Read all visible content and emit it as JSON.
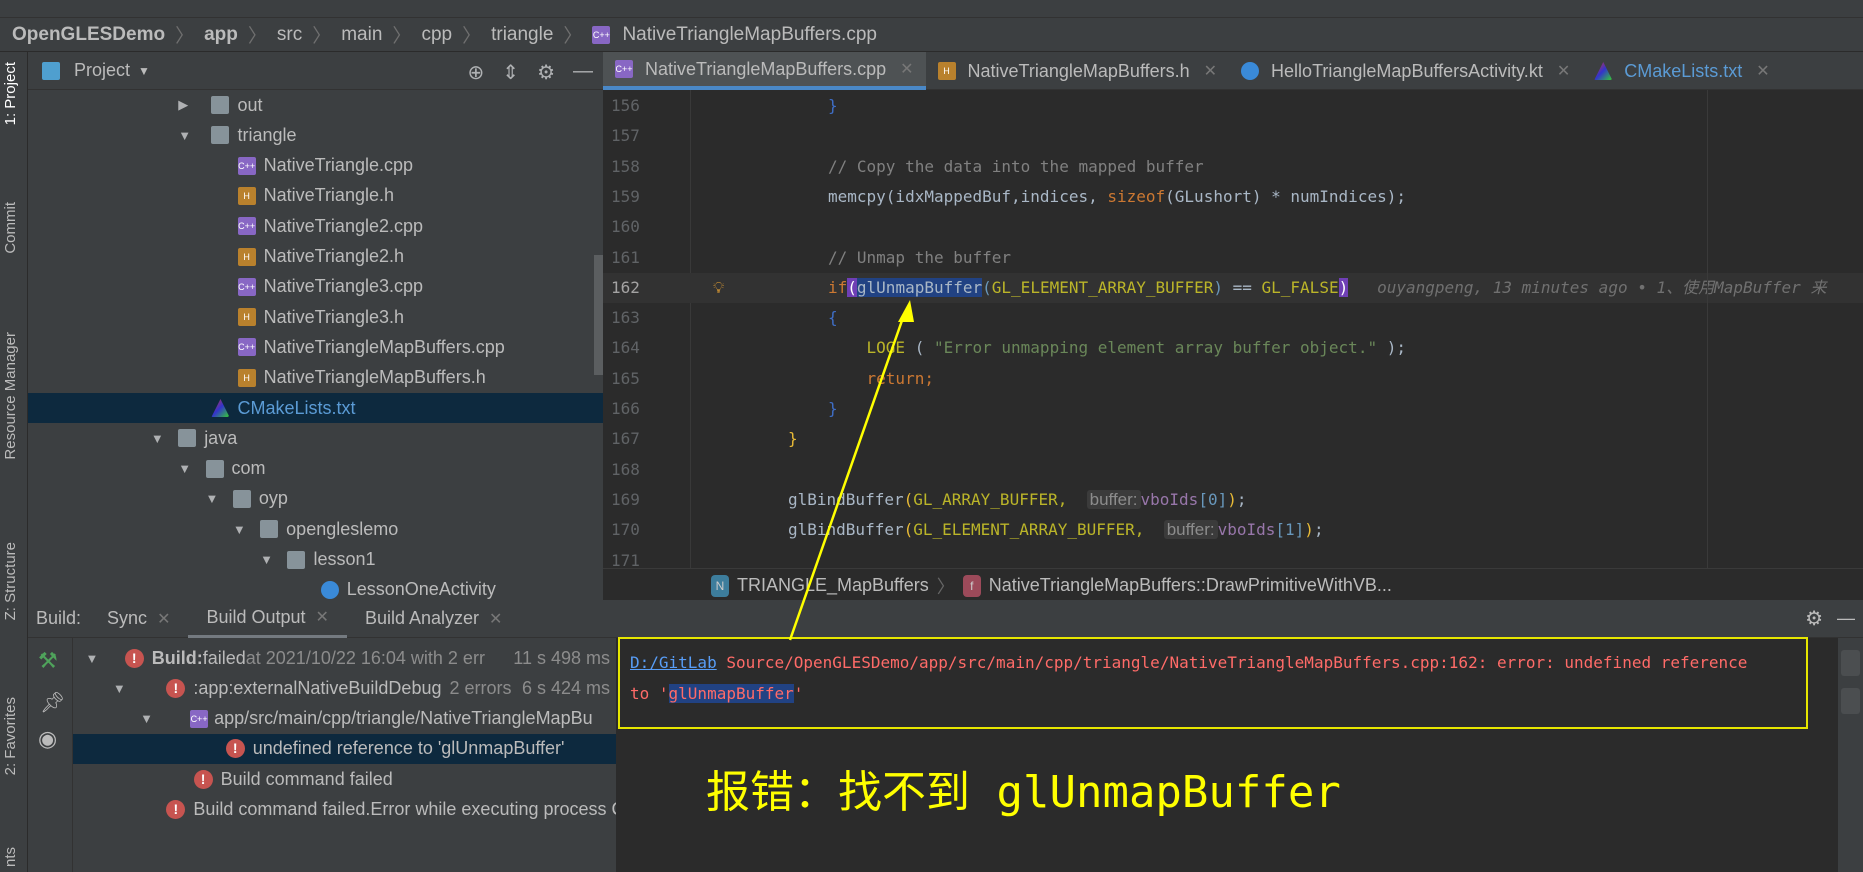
{
  "breadcrumb": [
    "OpenGLESDemo",
    "app",
    "src",
    "main",
    "cpp",
    "triangle",
    "NativeTriangleMapBuffers.cpp"
  ],
  "side_tools": {
    "project": "1: Project",
    "commit": "Commit",
    "resource_manager": "Resource Manager",
    "structure": "Z: Structure",
    "favorites": "2: Favorites",
    "variants": "nts"
  },
  "project_panel": {
    "title": "Project",
    "tree": [
      {
        "label": "out",
        "type": "folder",
        "expanded": false
      },
      {
        "label": "triangle",
        "type": "folder",
        "expanded": true
      },
      {
        "label": "NativeTriangle.cpp",
        "type": "cpp"
      },
      {
        "label": "NativeTriangle.h",
        "type": "h"
      },
      {
        "label": "NativeTriangle2.cpp",
        "type": "cpp"
      },
      {
        "label": "NativeTriangle2.h",
        "type": "h"
      },
      {
        "label": "NativeTriangle3.cpp",
        "type": "cpp"
      },
      {
        "label": "NativeTriangle3.h",
        "type": "h"
      },
      {
        "label": "NativeTriangleMapBuffers.cpp",
        "type": "cpp"
      },
      {
        "label": "NativeTriangleMapBuffers.h",
        "type": "h"
      },
      {
        "label": "CMakeLists.txt",
        "type": "cmake",
        "selected": true
      },
      {
        "label": "java",
        "type": "folder",
        "expanded": true
      },
      {
        "label": "com",
        "type": "folder",
        "expanded": true
      },
      {
        "label": "oyp",
        "type": "folder",
        "expanded": true
      },
      {
        "label": "opengleslemo",
        "type": "folder",
        "expanded": true
      },
      {
        "label": "lesson1",
        "type": "folder",
        "expanded": true
      },
      {
        "label": "LessonOneActivity",
        "type": "kt"
      }
    ]
  },
  "tabs": [
    {
      "label": "NativeTriangleMapBuffers.cpp",
      "type": "cpp",
      "active": true
    },
    {
      "label": "NativeTriangleMapBuffers.h",
      "type": "h"
    },
    {
      "label": "HelloTriangleMapBuffersActivity.kt",
      "type": "kt"
    },
    {
      "label": "CMakeLists.txt",
      "type": "cmake"
    }
  ],
  "editor": {
    "line_numbers": [
      "156",
      "157",
      "158",
      "159",
      "160",
      "161",
      "162",
      "163",
      "164",
      "165",
      "166",
      "167",
      "168",
      "169",
      "170",
      "171"
    ],
    "line_156": "}",
    "line_158": "// Copy the data into the mapped buffer",
    "line_159": {
      "a": "memcpy(idxMappedBuf,indices, ",
      "b": "sizeof",
      "c": "(GLushort) * numIndices);"
    },
    "line_161": "// Unmap the buffer",
    "line_162": {
      "kw": "if",
      "fn": "glUnmapBuffer",
      "arg": "GL_ELEMENT_ARRAY_BUFFER",
      "op": " == ",
      "val": "GL_FALSE",
      "blame": "ouyangpeng, 13 minutes ago • 1、使用MapBuffer 来"
    },
    "line_163": "{",
    "line_164": {
      "fn": "LOGE",
      "str": "\"Error unmapping element array buffer object.\""
    },
    "line_165": "return;",
    "line_166": "}",
    "line_167": "}",
    "line_169": {
      "fn": "glBindBuffer",
      "arg": "GL_ARRAY_BUFFER,",
      "hint": "buffer:",
      "var": "vboIds",
      "idx": "0"
    },
    "line_170": {
      "fn": "glBindBuffer",
      "arg": "GL_ELEMENT_ARRAY_BUFFER,",
      "hint": "buffer:",
      "var": "vboIds",
      "idx": "1"
    },
    "breadcrumb": [
      "TRIANGLE_MapBuffers",
      "NativeTriangleMapBuffers::DrawPrimitiveWithVB..."
    ]
  },
  "build": {
    "label": "Build:",
    "tabs": [
      "Sync",
      "Build Output",
      "Build Analyzer"
    ],
    "active_tab": "Build Output",
    "tree": [
      {
        "bold": "Build:",
        "text": " failed",
        "dim": " at 2021/10/22 16:04 with 2 err",
        "time": "11 s 498 ms"
      },
      {
        "text": ":app:externalNativeBuildDebug",
        "dim": "2 errors",
        "time": "6 s 424 ms"
      },
      {
        "text": "app/src/main/cpp/triangle/NativeTriangleMapBu"
      },
      {
        "text": "undefined reference to 'glUnmapBuffer'",
        "selected": true
      },
      {
        "text": "Build command failed"
      },
      {
        "text": "Build command failed.Error while executing process C"
      }
    ],
    "console": {
      "link": "D:/GitLab",
      "line1": " Source/OpenGLESDemo/app/src/main/cpp/triangle/NativeTriangleMapBuffers.cpp:162: error: undefined reference",
      "line2_pre": "to '",
      "highlight": "glUnmapBuffer",
      "line2_post": "'"
    }
  },
  "annotation": "报错：找不到 glUnmapBuffer",
  "colors": {
    "accent": "#4a88c7",
    "error": "#c75450",
    "annotation": "#ffff00",
    "selection": "#214283"
  }
}
